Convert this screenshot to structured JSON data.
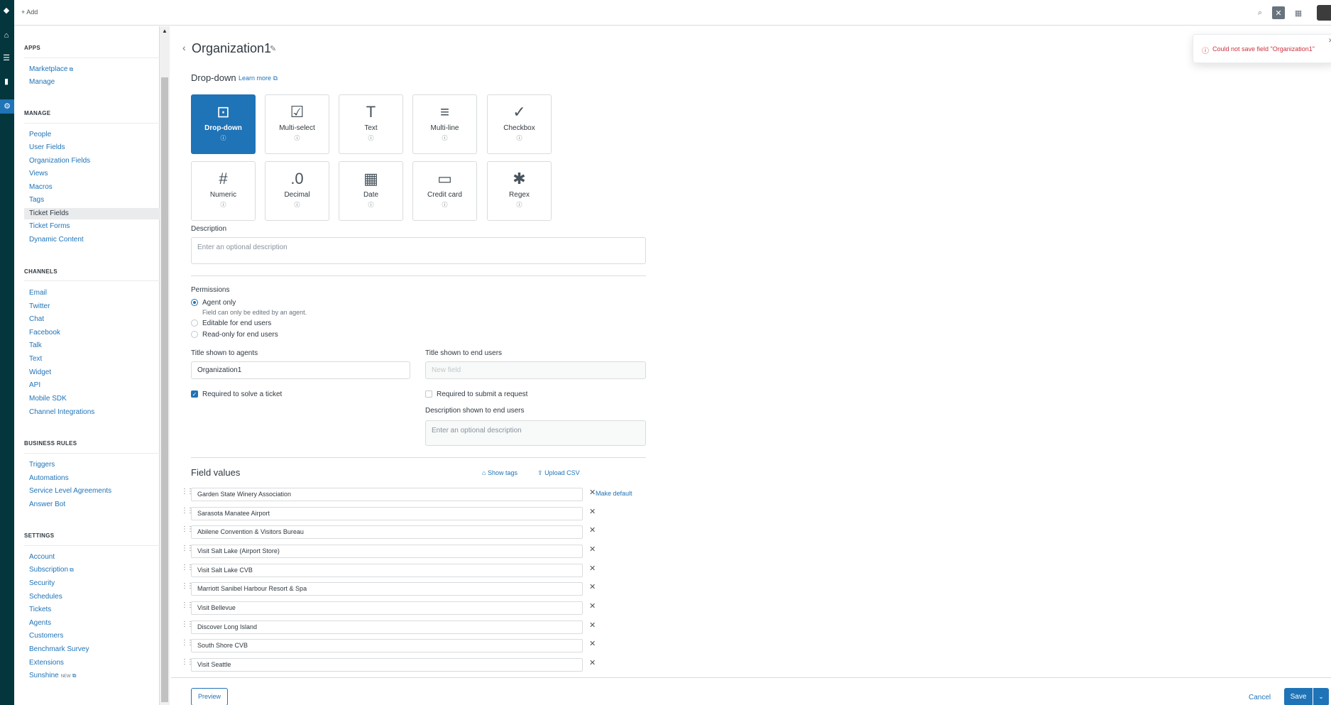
{
  "topbar": {
    "add_label": "+ Add",
    "icons": [
      "search-icon",
      "conversations-icon",
      "apps-grid-icon",
      "avatar"
    ]
  },
  "rail": {
    "icons": [
      "zendesk-logo-icon",
      "home-icon",
      "views-icon",
      "reporting-icon",
      "admin-gear-icon"
    ]
  },
  "sidebar": {
    "sections": {
      "apps": "APPS",
      "manage": "MANAGE",
      "channels": "CHANNELS",
      "business_rules": "BUSINESS RULES",
      "settings": "SETTINGS"
    },
    "apps": [
      "Marketplace",
      "Manage"
    ],
    "manage": [
      "People",
      "User Fields",
      "Organization Fields",
      "Views",
      "Macros",
      "Tags",
      "Ticket Fields",
      "Ticket Forms",
      "Dynamic Content"
    ],
    "channels": [
      "Email",
      "Twitter",
      "Chat",
      "Facebook",
      "Talk",
      "Text",
      "Widget",
      "API",
      "Mobile SDK",
      "Channel Integrations"
    ],
    "business_rules": [
      "Triggers",
      "Automations",
      "Service Level Agreements",
      "Answer Bot"
    ],
    "settings": [
      "Account",
      "Subscription",
      "Security",
      "Schedules",
      "Tickets",
      "Agents",
      "Customers",
      "Benchmark Survey",
      "Extensions",
      "Sunshine"
    ],
    "new_badge": "NEW",
    "selected": "Ticket Fields"
  },
  "page": {
    "title": "Organization1",
    "field_type": "Drop-down",
    "learn_more": "Learn more"
  },
  "tiles": [
    {
      "label": "Drop-down",
      "icon": "dropdown-icon",
      "selected": true
    },
    {
      "label": "Multi-select",
      "icon": "multiselect-icon"
    },
    {
      "label": "Text",
      "icon": "text-icon"
    },
    {
      "label": "Multi-line",
      "icon": "multiline-icon"
    },
    {
      "label": "Checkbox",
      "icon": "checkbox-icon"
    },
    {
      "label": "Numeric",
      "icon": "numeric-icon"
    },
    {
      "label": "Decimal",
      "icon": "decimal-icon"
    },
    {
      "label": "Date",
      "icon": "date-icon"
    },
    {
      "label": "Credit card",
      "icon": "credit-card-icon"
    },
    {
      "label": "Regex",
      "icon": "regex-icon"
    }
  ],
  "description": {
    "label": "Description",
    "placeholder": "Enter an optional description"
  },
  "permissions": {
    "label": "Permissions",
    "options": [
      "Agent only",
      "Editable for end users",
      "Read-only for end users"
    ],
    "agent_hint": "Field can only be edited by an agent.",
    "selected": "Agent only"
  },
  "agents": {
    "title_label": "Title shown to agents",
    "title_value": "Organization1",
    "required_label": "Required to solve a ticket",
    "required_checked": true
  },
  "end_users": {
    "title_label": "Title shown to end users",
    "title_placeholder": "New field",
    "required_label": "Required to submit a request",
    "required_checked": false,
    "desc_label": "Description shown to end users",
    "desc_placeholder": "Enter an optional description"
  },
  "field_values": {
    "title": "Field values",
    "show_tags": "Show tags",
    "upload_csv": "Upload CSV",
    "make_default": "Make default",
    "items": [
      "Garden State Winery Association",
      "Sarasota Manatee Airport",
      "Abilene Convention & Visitors Bureau",
      "Visit Salt Lake (Airport Store)",
      "Visit Salt Lake CVB",
      "Marriott Sanibel Harbour Resort & Spa",
      "Visit Bellevue",
      "Discover Long Island",
      "South Shore CVB",
      "Visit Seattle"
    ]
  },
  "footer": {
    "preview": "Preview",
    "cancel": "Cancel",
    "save": "Save"
  },
  "toast": {
    "message": "Could not save field \"Organization1\""
  },
  "colors": {
    "primary": "#1f73b7",
    "error": "#cc3340",
    "rail": "#03363d"
  }
}
